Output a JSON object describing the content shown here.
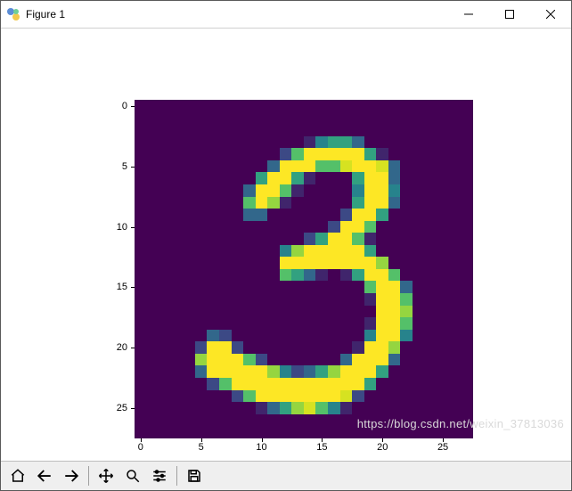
{
  "window": {
    "title": "Figure 1"
  },
  "toolbar": {
    "home": "Home",
    "back": "Back",
    "forward": "Forward",
    "pan": "Pan",
    "zoom": "Zoom",
    "configure": "Configure subplots",
    "save": "Save"
  },
  "watermark": "https://blog.csdn.net/weixin_37813036",
  "chart_data": {
    "type": "heatmap",
    "title": "",
    "xlabel": "",
    "ylabel": "",
    "x_ticks": [
      0,
      5,
      10,
      15,
      20,
      25
    ],
    "y_ticks": [
      0,
      5,
      10,
      15,
      20,
      25
    ],
    "xlim": [
      -0.5,
      27.5
    ],
    "ylim": [
      27.5,
      -0.5
    ],
    "colormap": "viridis",
    "grid": [
      "0000000000000000000000000000",
      "0000000000000000000000000000",
      "0000000000000000000000000000",
      "0000000000000014553000000000",
      "0000000000002699999510000000",
      "0000000000039996689983000000",
      "0000000000599510005993000000",
      "0000000003996100004994000000",
      "0000000006971000005993000000",
      "0000000003300000029950000000",
      "0000000000000000299600000000",
      "0000000000000025996100000000",
      "0000000000004799999500000000",
      "0000000000009999999970000000",
      "0000000000006531015996000000",
      "0000000000000000000699300000",
      "0000000000000000000199600000",
      "0000000000000000000099700000",
      "0000000000000000000199600000",
      "0000003200000000000499400000",
      "0000029920000000001997000000",
      "0000079996200000039993000000",
      "0000039999974235799950000000",
      "0000002699999999999500000000",
      "0000000026999999982000000000",
      "0000000000135786410000000000",
      "0000000000000000000000000000",
      "0000000000000000000000000000"
    ]
  }
}
